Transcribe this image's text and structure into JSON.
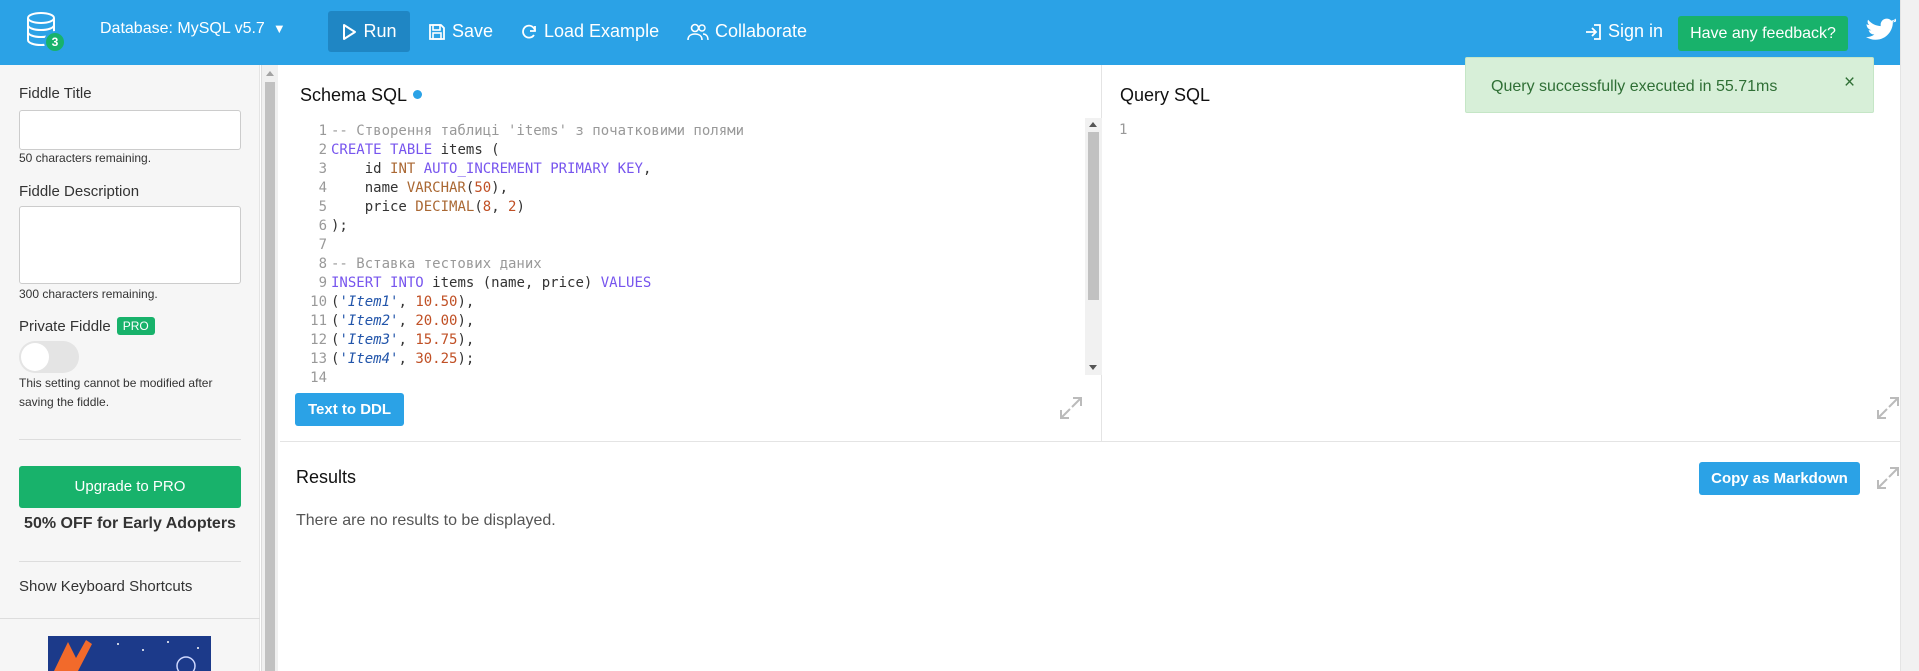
{
  "header": {
    "db_count": "3",
    "database_label": "Database: MySQL v5.7",
    "run_label": "Run",
    "save_label": "Save",
    "load_example_label": "Load Example",
    "collaborate_label": "Collaborate",
    "sign_in_label": "Sign in",
    "feedback_label": "Have any feedback?"
  },
  "sidebar": {
    "title_label": "Fiddle Title",
    "title_value": "",
    "title_remaining": "50 characters remaining.",
    "description_label": "Fiddle Description",
    "description_value": "",
    "description_remaining": "300 characters remaining.",
    "private_label": "Private Fiddle",
    "pro_badge": "PRO",
    "private_note": "This setting cannot be modified after saving the fiddle.",
    "upgrade_label": "Upgrade to PRO",
    "discount_text": "50% OFF for Early Adopters",
    "shortcuts_label": "Show Keyboard Shortcuts"
  },
  "schema": {
    "title": "Schema SQL",
    "text_to_ddl_label": "Text to DDL",
    "lines": [
      {
        "n": "1",
        "tokens": [
          {
            "t": "-- Створення таблиці 'items' з початковими полями",
            "c": "c-com"
          }
        ]
      },
      {
        "n": "2",
        "tokens": [
          {
            "t": "CREATE",
            "c": "c-kw"
          },
          {
            "t": " ",
            "c": "c-p"
          },
          {
            "t": "TABLE",
            "c": "c-kw"
          },
          {
            "t": " items (",
            "c": "c-p"
          }
        ]
      },
      {
        "n": "3",
        "tokens": [
          {
            "t": "    id ",
            "c": "c-p"
          },
          {
            "t": "INT",
            "c": "c-ty"
          },
          {
            "t": " ",
            "c": "c-p"
          },
          {
            "t": "AUTO_INCREMENT",
            "c": "c-kw"
          },
          {
            "t": " ",
            "c": "c-p"
          },
          {
            "t": "PRIMARY",
            "c": "c-kw"
          },
          {
            "t": " ",
            "c": "c-p"
          },
          {
            "t": "KEY",
            "c": "c-kw"
          },
          {
            "t": ",",
            "c": "c-p"
          }
        ]
      },
      {
        "n": "4",
        "tokens": [
          {
            "t": "    name ",
            "c": "c-p"
          },
          {
            "t": "VARCHAR",
            "c": "c-ty"
          },
          {
            "t": "(",
            "c": "c-p"
          },
          {
            "t": "50",
            "c": "c-num"
          },
          {
            "t": "),",
            "c": "c-p"
          }
        ]
      },
      {
        "n": "5",
        "tokens": [
          {
            "t": "    price ",
            "c": "c-p"
          },
          {
            "t": "DECIMAL",
            "c": "c-ty"
          },
          {
            "t": "(",
            "c": "c-p"
          },
          {
            "t": "8",
            "c": "c-num"
          },
          {
            "t": ", ",
            "c": "c-p"
          },
          {
            "t": "2",
            "c": "c-num"
          },
          {
            "t": ")",
            "c": "c-p"
          }
        ]
      },
      {
        "n": "6",
        "tokens": [
          {
            "t": ");",
            "c": "c-p"
          }
        ]
      },
      {
        "n": "7",
        "tokens": []
      },
      {
        "n": "8",
        "tokens": [
          {
            "t": "-- Вставка тестових даних",
            "c": "c-com"
          }
        ]
      },
      {
        "n": "9",
        "tokens": [
          {
            "t": "INSERT",
            "c": "c-kw"
          },
          {
            "t": " ",
            "c": "c-p"
          },
          {
            "t": "INTO",
            "c": "c-kw"
          },
          {
            "t": " items (name, price) ",
            "c": "c-p"
          },
          {
            "t": "VALUES",
            "c": "c-kw"
          }
        ]
      },
      {
        "n": "10",
        "tokens": [
          {
            "t": "(",
            "c": "c-p"
          },
          {
            "t": "'Item1'",
            "c": "c-str"
          },
          {
            "t": ", ",
            "c": "c-p"
          },
          {
            "t": "10.50",
            "c": "c-num"
          },
          {
            "t": "),",
            "c": "c-p"
          }
        ]
      },
      {
        "n": "11",
        "tokens": [
          {
            "t": "(",
            "c": "c-p"
          },
          {
            "t": "'Item2'",
            "c": "c-str"
          },
          {
            "t": ", ",
            "c": "c-p"
          },
          {
            "t": "20.00",
            "c": "c-num"
          },
          {
            "t": "),",
            "c": "c-p"
          }
        ]
      },
      {
        "n": "12",
        "tokens": [
          {
            "t": "(",
            "c": "c-p"
          },
          {
            "t": "'Item3'",
            "c": "c-str"
          },
          {
            "t": ", ",
            "c": "c-p"
          },
          {
            "t": "15.75",
            "c": "c-num"
          },
          {
            "t": "),",
            "c": "c-p"
          }
        ]
      },
      {
        "n": "13",
        "tokens": [
          {
            "t": "(",
            "c": "c-p"
          },
          {
            "t": "'Item4'",
            "c": "c-str"
          },
          {
            "t": ", ",
            "c": "c-p"
          },
          {
            "t": "30.25",
            "c": "c-num"
          },
          {
            "t": ");",
            "c": "c-p"
          }
        ]
      },
      {
        "n": "14",
        "tokens": []
      }
    ]
  },
  "query": {
    "title": "Query SQL",
    "line_number": "1"
  },
  "results": {
    "title": "Results",
    "empty_text": "There are no results to be displayed.",
    "copy_label": "Copy as Markdown"
  },
  "toast": {
    "message": "Query successfully executed in 55.71ms",
    "close": "×"
  },
  "colors": {
    "topbar": "#2ba2e6",
    "accent_green": "#18b26b",
    "toast_bg": "#d7efd8"
  }
}
